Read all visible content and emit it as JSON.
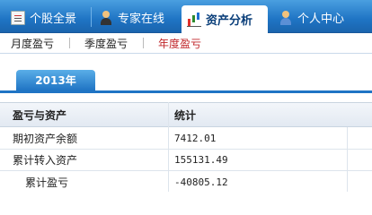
{
  "top_tabs": [
    {
      "label": "个股全景",
      "icon": "document-icon"
    },
    {
      "label": "专家在线",
      "icon": "expert-icon"
    },
    {
      "label": "资产分析",
      "icon": "chart-icon",
      "active": true
    },
    {
      "label": "个人中心",
      "icon": "person-icon"
    }
  ],
  "sub_tabs": [
    {
      "label": "月度盈亏"
    },
    {
      "label": "季度盈亏"
    },
    {
      "label": "年度盈亏",
      "active": true
    }
  ],
  "year_tab": {
    "label": "2013年"
  },
  "table": {
    "headers": [
      "盈亏与资产",
      "统计"
    ],
    "rows": [
      {
        "label": "期初资产余额",
        "value": "7412.01"
      },
      {
        "label": "累计转入资产",
        "value": "155131.49"
      },
      {
        "label": "累计盈亏",
        "value": "-40805.12"
      }
    ]
  },
  "colors": {
    "nav_blue": "#1f74c4",
    "active_subtab": "#c0262a"
  }
}
